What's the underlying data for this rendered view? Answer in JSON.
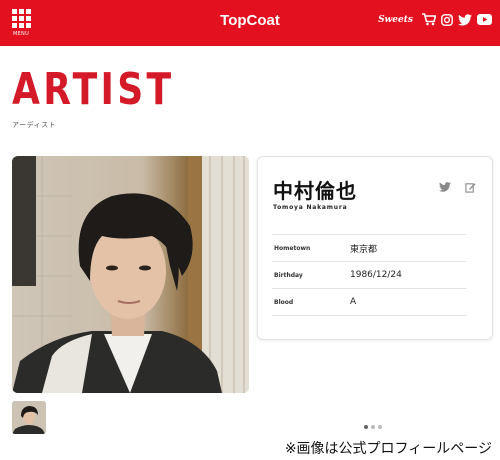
{
  "header": {
    "menu_label": "MENU",
    "brand": "TopCoat",
    "sweets_label": "Sweets",
    "colors": {
      "bar": "#e3101f"
    },
    "icons": [
      "cart-icon",
      "instagram-icon",
      "twitter-icon",
      "youtube-icon"
    ]
  },
  "page": {
    "title": "ARTIST",
    "subtitle": "アーディスト"
  },
  "profile": {
    "name": "中村倫也",
    "name_roman": "Tomoya Nakamura",
    "rows": [
      {
        "label": "Hometown",
        "value": "東京都"
      },
      {
        "label": "Birthday",
        "value": "1986/12/24"
      },
      {
        "label": "Blood",
        "value": "A"
      }
    ]
  },
  "caption": "※画像は公式プロフィールページ"
}
